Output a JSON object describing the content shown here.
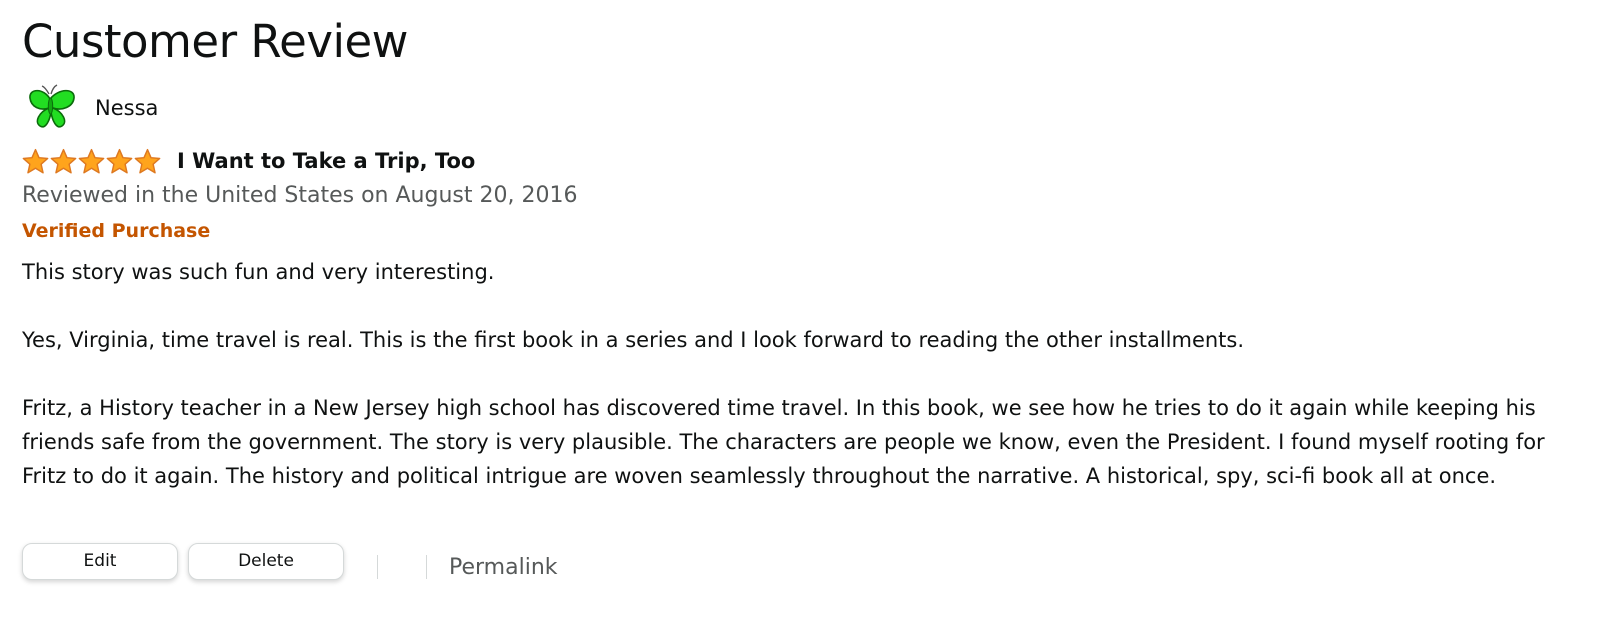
{
  "page": {
    "title": "Customer Review"
  },
  "profile": {
    "name": "Nessa",
    "avatar": "green-butterfly-avatar"
  },
  "review": {
    "rating": 5,
    "rating_max": 5,
    "title": "I Want to Take a Trip, Too",
    "date_line": "Reviewed in the United States on August 20, 2016",
    "verified_label": "Verified Purchase",
    "paragraphs": [
      "This story was such fun and very interesting.",
      "Yes, Virginia, time travel is real. This is the first book in a series and I look forward to reading the other installments.",
      "Fritz, a History teacher in a New Jersey high school has discovered time travel. In this book, we see how he tries to do it again while keeping his friends safe from the government. The story is very plausible. The characters are people we know, even the President. I found myself rooting for Fritz to do it again. The history and political intrigue are woven seamlessly throughout the narrative. A historical, spy, sci-fi book all at once."
    ]
  },
  "actions": {
    "edit_label": "Edit",
    "delete_label": "Delete",
    "permalink_label": "Permalink"
  },
  "colors": {
    "text": "#0f1111",
    "secondary_text": "#565959",
    "verified": "#c45500",
    "star_fill": "#ffa41c",
    "star_stroke": "#de7921",
    "avatar_green": "#22dd22",
    "button_border": "#d5d9d9"
  }
}
